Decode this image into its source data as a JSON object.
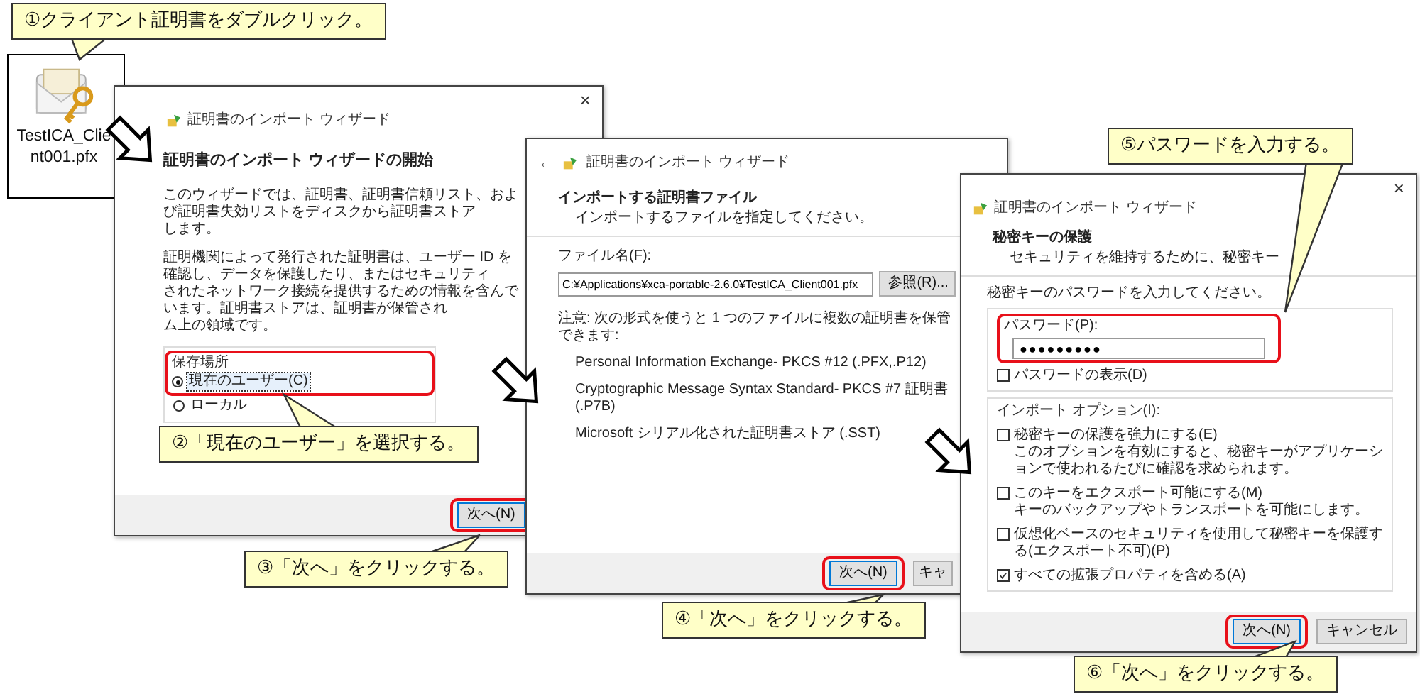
{
  "steps": [
    {
      "text": "①クライアント証明書をダブルクリック。"
    },
    {
      "text": "②「現在のユーザー」を選択する。"
    },
    {
      "text": "③「次へ」をクリックする。"
    },
    {
      "text": "④「次へ」をクリックする。"
    },
    {
      "text": "⑤パスワードを入力する。"
    },
    {
      "text": "⑥「次へ」をクリックする。"
    }
  ],
  "file_icon": {
    "label": "TestICA_Client001.pfx"
  },
  "wizard_start": {
    "close": "×",
    "title": "証明書のインポート ウィザード",
    "heading": "証明書のインポート ウィザードの開始",
    "paragraphs": [
      [
        "このウィザードでは、証明書、証明書信頼リスト、および証明書失効リストをディスクから証明書ストア",
        "します。"
      ],
      [
        "証明機関によって発行された証明書は、ユーザー ID を確認し、データを保護したり、またはセキュリティ",
        "されたネットワーク接続を提供するための情報を含んでいます。証明書ストアは、証明書が保管され",
        "ム上の領域です。"
      ]
    ],
    "storage": {
      "label": "保存場所",
      "highlighted": true,
      "options": [
        {
          "label": "現在のユーザー(C)",
          "selected": true
        },
        {
          "label": "ローカル",
          "selected": false
        }
      ]
    },
    "buttons": [
      {
        "label": "次へ(N)",
        "default": true,
        "highlighted": true
      }
    ]
  },
  "file_page": {
    "back": "←",
    "title": "証明書のインポート ウィザード",
    "section": "インポートする証明書ファイル",
    "instruction": "インポートするファイルを指定してください。",
    "field_label": "ファイル名(F):",
    "value": "C:¥Applications¥xca-portable-2.6.0¥TestICA_Client001.pfx",
    "browse": "参照(R)...",
    "note": "注意: 次の形式を使うと 1 つのファイルに複数の証明書を保管できます:",
    "formats": [
      "Personal Information Exchange- PKCS #12 (.PFX,.P12)",
      "Cryptographic Message Syntax Standard- PKCS #7 証明書 (.P7B)",
      "Microsoft シリアル化された証明書ストア (.SST)"
    ],
    "buttons": [
      {
        "label": "次へ(N)",
        "default": true,
        "highlighted": true
      },
      {
        "label": "キャ",
        "default": false,
        "highlighted": false
      }
    ]
  },
  "password_page": {
    "close": "×",
    "title": "証明書のインポート ウィザード",
    "section": "秘密キーの保護",
    "instruction": "セキュリティを維持するために、秘密キー",
    "prompt": "秘密キーのパスワードを入力してください。",
    "password": {
      "label": "パスワード(P):",
      "value": "●●●●●●●●●",
      "highlighted": true
    },
    "show_password": {
      "label": "パスワードの表示(D)",
      "checked": false
    },
    "options_label": "インポート オプション(I):",
    "options": [
      {
        "label": "秘密キーの保護を強力にする(E)",
        "description": "このオプションを有効にすると、秘密キーがアプリケーションで使われるたびに確認を求められます。",
        "checked": false
      },
      {
        "label": "このキーをエクスポート可能にする(M)",
        "description": "キーのバックアップやトランスポートを可能にします。",
        "checked": false
      },
      {
        "label": "仮想化ベースのセキュリティを使用して秘密キーを保護する(エクスポート不可)(P)",
        "checked": false
      },
      {
        "label": "すべての拡張プロパティを含める(A)",
        "checked": true
      }
    ],
    "buttons": [
      {
        "label": "次へ(N)",
        "default": true,
        "highlighted": true
      },
      {
        "label": "キャンセル",
        "default": false,
        "highlighted": false
      }
    ]
  }
}
